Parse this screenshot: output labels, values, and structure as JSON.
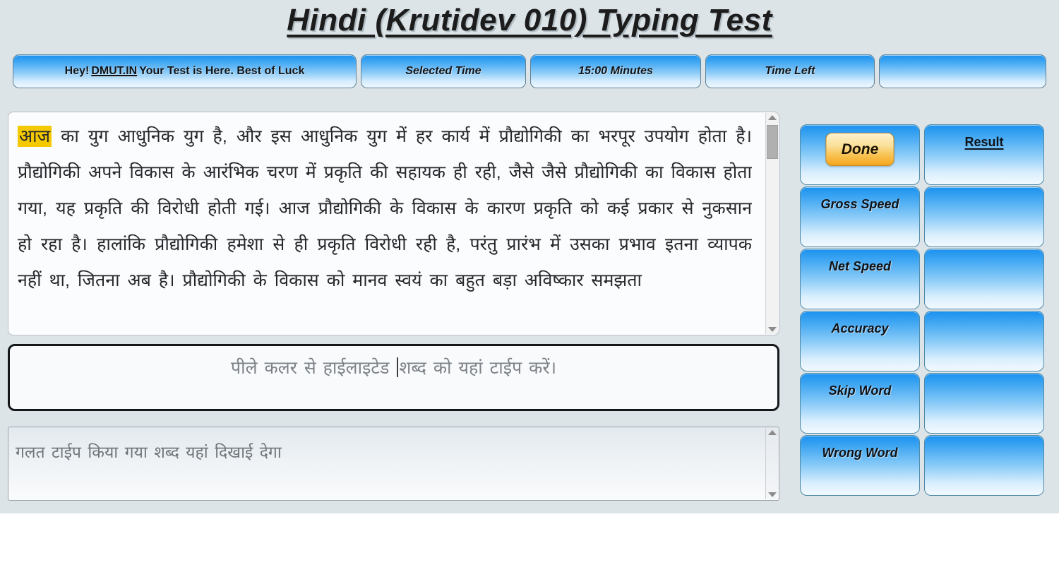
{
  "page": {
    "title": "Hindi (Krutidev 010) Typing Test",
    "background_color": "#dde4e8",
    "accent_blue": "#1b91ef",
    "highlight_color": "#f4c900",
    "done_button_color": "#f5a61f"
  },
  "infobar": {
    "greeting_prefix": "Hey!",
    "greeting_brand": "DMUT.IN",
    "greeting_suffix": "Your Test is Here. Best of Luck",
    "selected_time_label": "Selected Time",
    "selected_time_value": "15:00 Minutes",
    "time_left_label": "Time Left",
    "time_left_value": ""
  },
  "passage": {
    "highlighted_word": "आज",
    "rest": "का युग आधुनिक युग है, और इस आधुनिक युग में हर कार्य में प्रौद्योगिकी का भरपूर उपयोग होता है। प्रौद्योगिकी अपने विकास के आरंभिक चरण में प्रकृति की सहायक ही रही, जैसे जैसे प्रौद्योगिकी का विकास होता गया, यह प्रकृति की विरोधी होती गई। आज प्रौद्योगिकी के विकास के कारण प्रकृति को कई प्रकार से नुकसान हो रहा है। हालांकि प्रौद्योगिकी हमेशा से ही प्रकृति विरोधी रही है, परंतु प्रारंभ में उसका प्रभाव इतना व्यापक नहीं था, जितना अब है। प्रौद्योगिकी के विकास को मानव स्वयं का बहुत बड़ा अविष्कार समझता"
  },
  "typing_input": {
    "placeholder_before_caret": "पीले कलर से हाईलाइटेड ",
    "placeholder_after_caret": "शब्द को यहां टाईप करें।",
    "value": ""
  },
  "wrong_word_box": {
    "placeholder": "गलत टाईप किया गया शब्द यहां दिखाई देगा",
    "value": ""
  },
  "stats": {
    "done_label": "Done",
    "result_label": "Result",
    "rows": [
      {
        "label": "Gross Speed",
        "value": ""
      },
      {
        "label": "Net Speed",
        "value": ""
      },
      {
        "label": "Accuracy",
        "value": ""
      },
      {
        "label": "Skip Word",
        "value": ""
      },
      {
        "label": "Wrong Word",
        "value": ""
      }
    ]
  }
}
